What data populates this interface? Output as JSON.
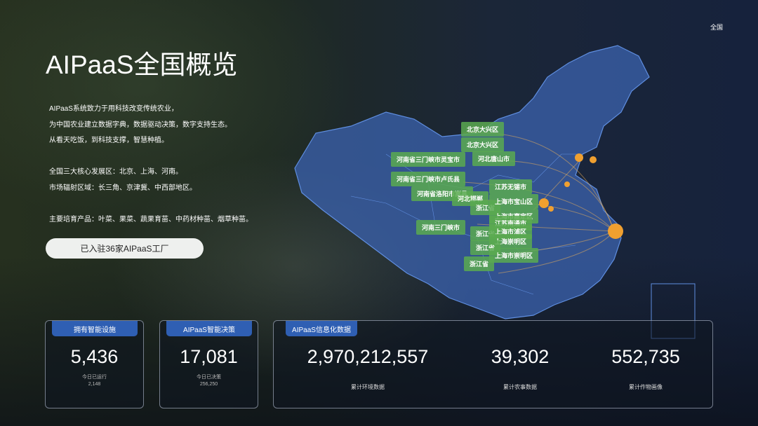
{
  "region_selector": "全国",
  "title": "AIPaaS全国概览",
  "description": [
    "AIPaaS系统致力于用科技改变传统农业，",
    "为中国农业建立数据字典，数据驱动决策，数字支持生态。",
    "从看天吃饭，到科技支撑，智慧种植。",
    "",
    "全国三大核心发展区：北京、上海、河南。",
    "市场辐射区域：长三角、京津冀、中西部地区。",
    "",
    "主要培育产品：叶菜、果菜、蔬果育苗、中药材种苗、烟草种苗。"
  ],
  "cta": "已入驻36家AIPaaS工厂",
  "map_labels": [
    "北京大兴区",
    "北京大兴区",
    "河南省三门峡市灵宝市",
    "河北唐山市",
    "河南省三门峡市卢氏县",
    "河南省洛阳市嵩县",
    "河北邯郸",
    "江苏无锡市",
    "上海市宝山区",
    "浙江省",
    "上海市嘉定区",
    "江苏南通市",
    "上海市浦区",
    "上海崇明区",
    "河南三门峡市",
    "浙江省",
    "浙江省",
    "上海市崇明区",
    "浙江省"
  ],
  "cards": {
    "facilities": {
      "tag": "拥有智能设施",
      "value": "5,436",
      "sub_label": "今日已运行",
      "sub_value": "2,148"
    },
    "decisions": {
      "tag": "AIPaaS智能决策",
      "value": "17,081",
      "sub_label": "今日已决策",
      "sub_value": "256,250"
    },
    "data": {
      "tag": "AIPaaS信息化数据",
      "metrics": [
        {
          "value": "2,970,212,557",
          "label": "累计环境数据"
        },
        {
          "value": "39,302",
          "label": "累计农事数据"
        },
        {
          "value": "552,735",
          "label": "累计作物画像"
        }
      ]
    }
  },
  "colors": {
    "tag": "#2f5fb3",
    "map_fill": "#3a5fa8",
    "label": "#5aaa50",
    "hotspot": "#f0a030"
  }
}
